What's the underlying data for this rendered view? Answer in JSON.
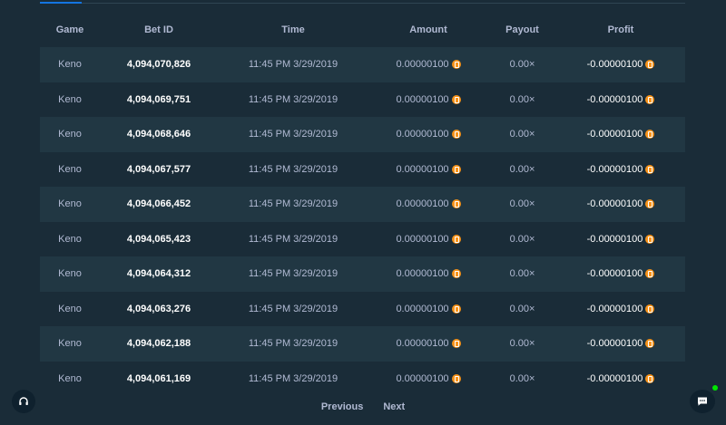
{
  "table": {
    "headers": [
      "Game",
      "Bet ID",
      "Time",
      "Amount",
      "Payout",
      "Profit"
    ],
    "rows": [
      {
        "game": "Keno",
        "bet_id": "4,094,070,826",
        "time": "11:45 PM 3/29/2019",
        "amount": "0.00000100",
        "payout": "0.00×",
        "profit": "-0.00000100"
      },
      {
        "game": "Keno",
        "bet_id": "4,094,069,751",
        "time": "11:45 PM 3/29/2019",
        "amount": "0.00000100",
        "payout": "0.00×",
        "profit": "-0.00000100"
      },
      {
        "game": "Keno",
        "bet_id": "4,094,068,646",
        "time": "11:45 PM 3/29/2019",
        "amount": "0.00000100",
        "payout": "0.00×",
        "profit": "-0.00000100"
      },
      {
        "game": "Keno",
        "bet_id": "4,094,067,577",
        "time": "11:45 PM 3/29/2019",
        "amount": "0.00000100",
        "payout": "0.00×",
        "profit": "-0.00000100"
      },
      {
        "game": "Keno",
        "bet_id": "4,094,066,452",
        "time": "11:45 PM 3/29/2019",
        "amount": "0.00000100",
        "payout": "0.00×",
        "profit": "-0.00000100"
      },
      {
        "game": "Keno",
        "bet_id": "4,094,065,423",
        "time": "11:45 PM 3/29/2019",
        "amount": "0.00000100",
        "payout": "0.00×",
        "profit": "-0.00000100"
      },
      {
        "game": "Keno",
        "bet_id": "4,094,064,312",
        "time": "11:45 PM 3/29/2019",
        "amount": "0.00000100",
        "payout": "0.00×",
        "profit": "-0.00000100"
      },
      {
        "game": "Keno",
        "bet_id": "4,094,063,276",
        "time": "11:45 PM 3/29/2019",
        "amount": "0.00000100",
        "payout": "0.00×",
        "profit": "-0.00000100"
      },
      {
        "game": "Keno",
        "bet_id": "4,094,062,188",
        "time": "11:45 PM 3/29/2019",
        "amount": "0.00000100",
        "payout": "0.00×",
        "profit": "-0.00000100"
      },
      {
        "game": "Keno",
        "bet_id": "4,094,061,169",
        "time": "11:45 PM 3/29/2019",
        "amount": "0.00000100",
        "payout": "0.00×",
        "profit": "-0.00000100"
      }
    ]
  },
  "pagination": {
    "previous_label": "Previous",
    "next_label": "Next"
  },
  "icons": {
    "currency": "bitcoin-icon",
    "support": "headset-icon",
    "chat": "chat-bubble-icon"
  },
  "colors": {
    "background": "#1a2c38",
    "row_alt": "#213743",
    "accent": "#1475e1",
    "currency": "#f7931a",
    "online": "#00e701"
  }
}
